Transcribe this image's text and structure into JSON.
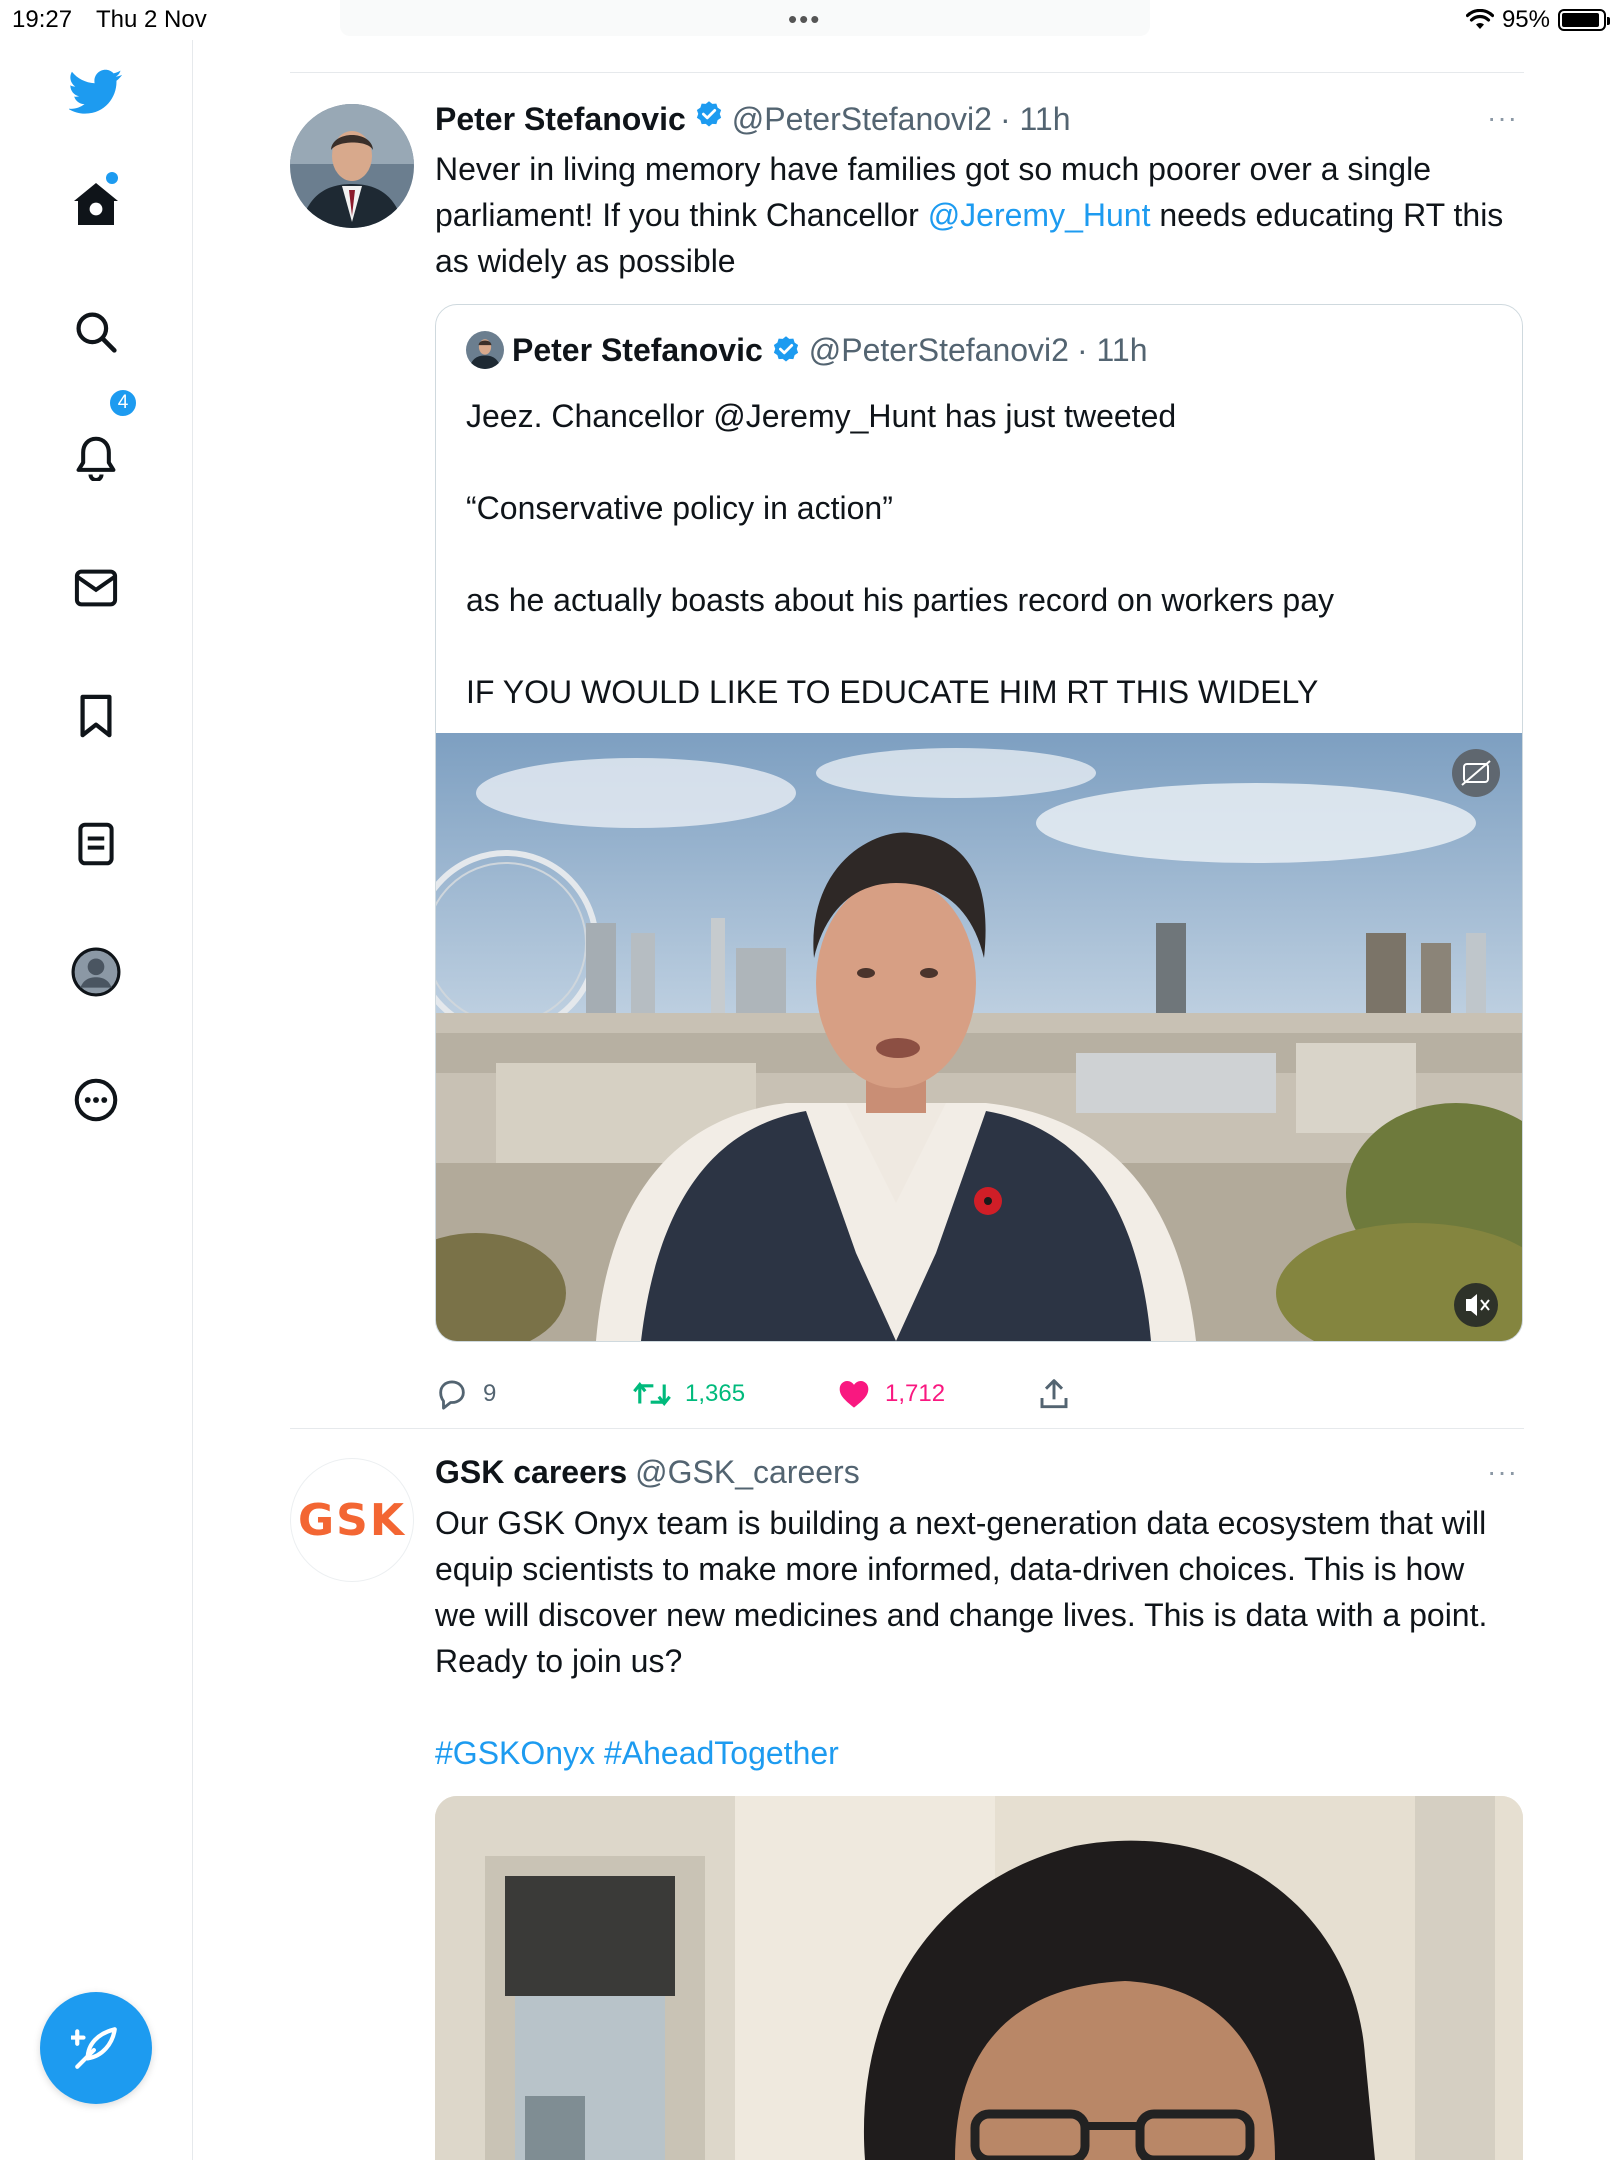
{
  "status_bar": {
    "time": "19:27",
    "date": "Thu 2 Nov",
    "battery": "95%"
  },
  "colors": {
    "accent": "#1d9bf0",
    "retweet": "#00ba7c",
    "like": "#f91880",
    "text": "#0f1419",
    "muted": "#536471",
    "gsk_orange": "#f36633"
  },
  "sidebar": {
    "items": [
      {
        "icon": "twitter-bird-icon"
      },
      {
        "icon": "home-icon"
      },
      {
        "icon": "search-icon"
      },
      {
        "icon": "bell-icon"
      },
      {
        "icon": "mail-icon"
      },
      {
        "icon": "bookmark-icon"
      },
      {
        "icon": "list-icon"
      },
      {
        "icon": "profile-icon"
      },
      {
        "icon": "more-icon"
      }
    ],
    "notifications_badge": "4"
  },
  "tweet1": {
    "name": "Peter Stefanovic",
    "handle": "@PeterStefanovi2",
    "time": "· 11h",
    "more": "···",
    "text_parts": {
      "before": "Never in living memory have families got so much poorer over a single parliament! If you think Chancellor ",
      "mention": "@Jeremy_Hunt",
      "after": " needs educating RT this as widely as possible"
    },
    "quote": {
      "name": "Peter Stefanovic",
      "handle": "@PeterStefanovi2",
      "time": "· 11h",
      "lines": [
        "Jeez. Chancellor @Jeremy_Hunt has just tweeted",
        "“Conservative policy in action”",
        "as he actually boasts about his parties record on workers pay",
        "IF YOU WOULD LIKE TO EDUCATE HIM RT THIS WIDELY"
      ]
    },
    "stats": {
      "replies": "9",
      "retweets": "1,365",
      "likes": "1,712"
    }
  },
  "tweet2": {
    "name": "GSK careers",
    "handle": "@GSK_careers",
    "more": "···",
    "logo_text": "GSK",
    "text": "Our GSK Onyx team is building a next-generation data ecosystem that will equip scientists to make more informed, data-driven choices. This is how we will discover new medicines and change lives. This is data with a point. Ready to join us?",
    "hashtags": "#GSKOnyx #AheadTogether"
  }
}
